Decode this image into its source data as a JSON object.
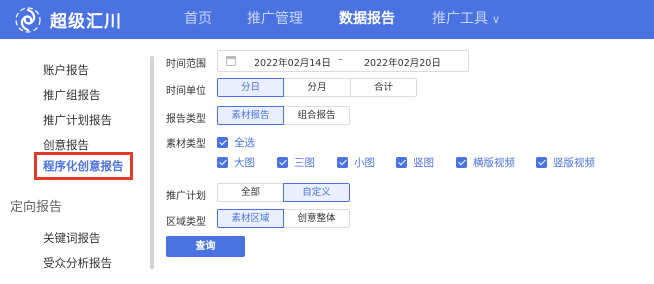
{
  "brand": {
    "name": "超级汇川"
  },
  "topnav": {
    "items": [
      {
        "label": "首页"
      },
      {
        "label": "推广管理"
      },
      {
        "label": "数据报告"
      },
      {
        "label": "推广工具"
      }
    ],
    "active": "数据报告"
  },
  "sidebar": {
    "items": [
      {
        "label": "账户报告"
      },
      {
        "label": "推广组报告"
      },
      {
        "label": "推广计划报告"
      },
      {
        "label": "创意报告"
      },
      {
        "label": "程序化创意报告"
      }
    ],
    "active": "程序化创意报告",
    "section2": {
      "title": "定向报告",
      "items": [
        {
          "label": "关键词报告"
        },
        {
          "label": "受众分析报告"
        }
      ]
    }
  },
  "form": {
    "time_range": {
      "label": "时间范围",
      "start": "2022年02月14日",
      "separator": "–",
      "end": "2022年02月20日"
    },
    "time_unit": {
      "label": "时间单位",
      "options": [
        "分日",
        "分月",
        "合计"
      ],
      "selected": "分日"
    },
    "report_type": {
      "label": "报告类型",
      "options": [
        "素材报告",
        "组合报告"
      ],
      "selected": "素材报告"
    },
    "material_type": {
      "label": "素材类型",
      "select_all": "全选",
      "options": [
        "大图",
        "三图",
        "小图",
        "竖图",
        "横版视频",
        "竖版视频"
      ],
      "all_checked": true
    },
    "plan": {
      "label": "推广计划",
      "options": [
        "全部",
        "自定义"
      ],
      "selected": "自定义"
    },
    "region_type": {
      "label": "区域类型",
      "options": [
        "素材区域",
        "创意整体"
      ],
      "selected": "素材区域"
    },
    "query_button": "查询"
  },
  "colors": {
    "brand_blue": "#4a73e1",
    "highlight_red": "#e53b2c",
    "selected_bg": "#eaf0ff"
  },
  "icons": {
    "logo": "swirl-logo-icon",
    "calendar": "calendar-icon",
    "dropdown": "chevron-down-icon",
    "check": "checkmark-icon"
  }
}
